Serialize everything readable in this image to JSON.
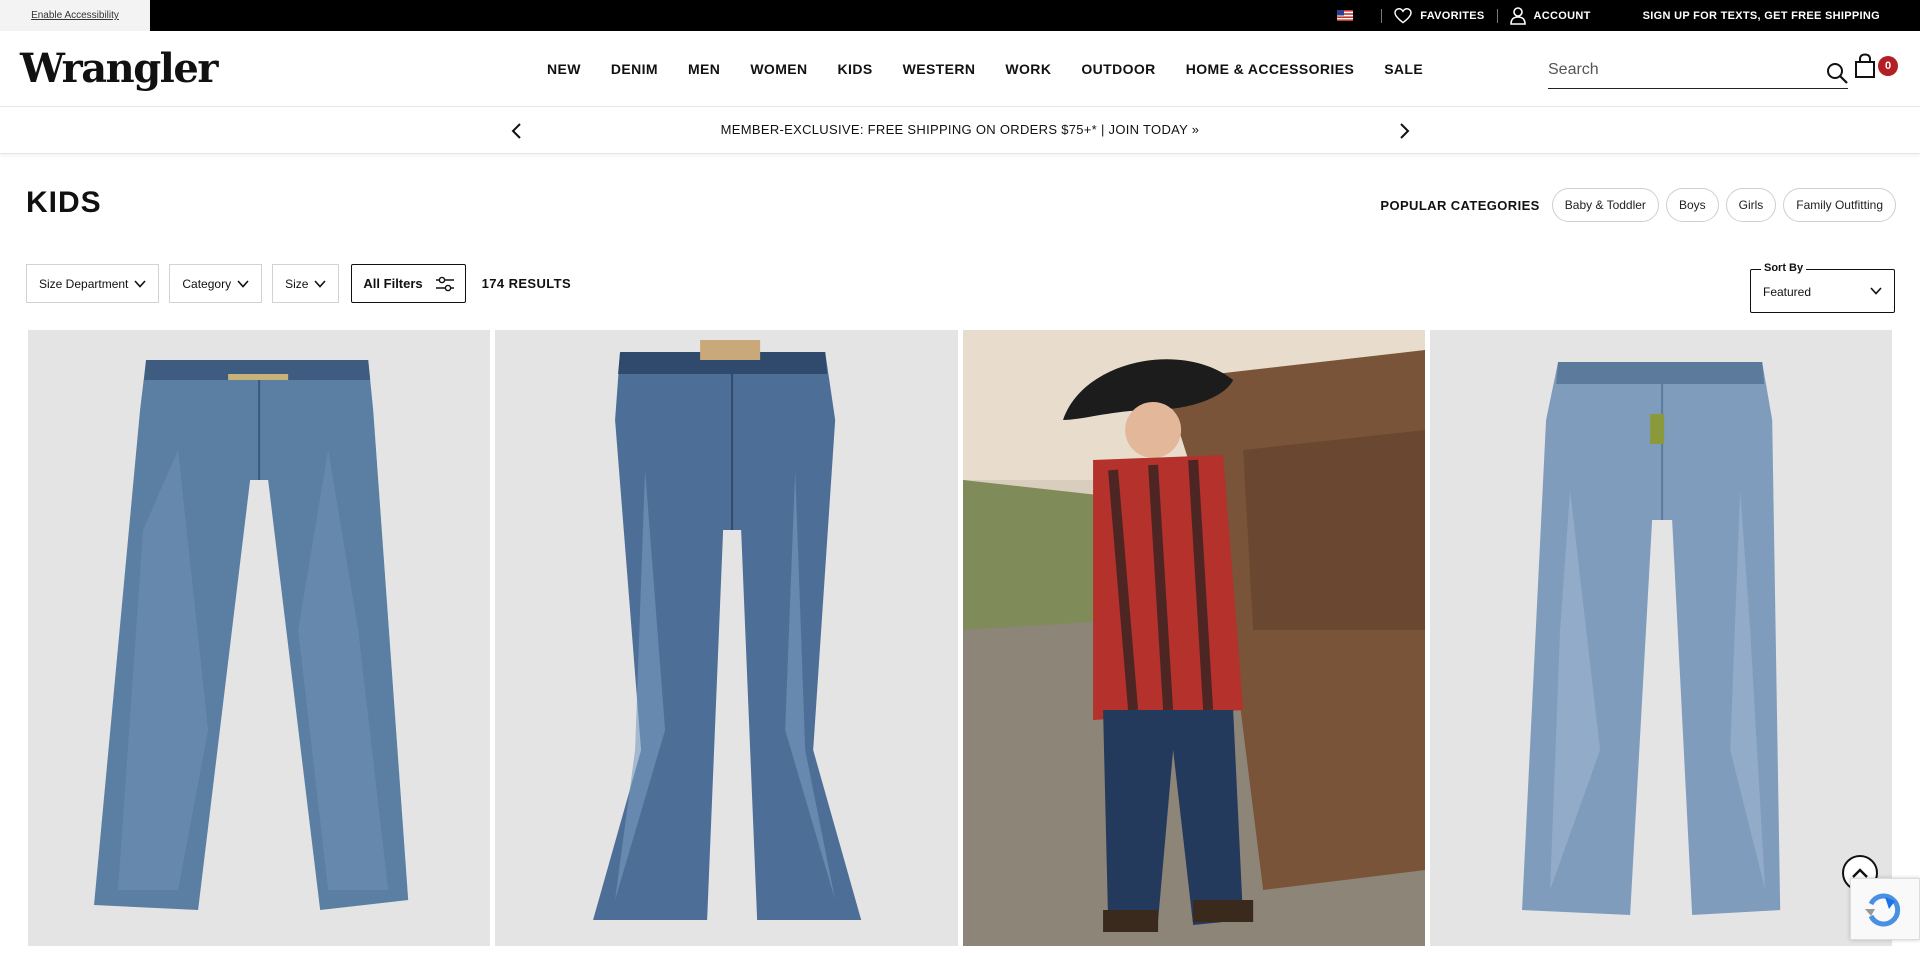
{
  "utility": {
    "accessibility": "Enable Accessibility",
    "favorites": "FAVORITES",
    "account": "ACCOUNT",
    "sms": "SIGN UP FOR TEXTS, GET FREE SHIPPING"
  },
  "header": {
    "logo": "Wrangler",
    "nav": [
      "NEW",
      "DENIM",
      "MEN",
      "WOMEN",
      "KIDS",
      "WESTERN",
      "WORK",
      "OUTDOOR",
      "HOME & ACCESSORIES",
      "SALE"
    ],
    "search_placeholder": "Search",
    "bag_count": "0"
  },
  "promo": {
    "text": "MEMBER-EXCLUSIVE: FREE SHIPPING ON ORDERS $75+* | JOIN TODAY »"
  },
  "page": {
    "title": "KIDS",
    "popular_label": "POPULAR CATEGORIES",
    "categories": [
      "Baby & Toddler",
      "Boys",
      "Girls",
      "Family Outfitting"
    ]
  },
  "filters": {
    "buttons": [
      "Size Department",
      "Category",
      "Size"
    ],
    "all_filters": "All Filters",
    "results": "174 RESULTS"
  },
  "sort": {
    "label": "Sort By",
    "value": "Featured"
  },
  "colors": {
    "top_bar": "#000000",
    "badge": "#b21f24",
    "tile_bg": "#e4e4e4",
    "denim_dark": "#4a6a8c",
    "denim_light": "#7f9cb9"
  },
  "products": [
    {
      "image": "relaxed-boot-jeans-mid-wash"
    },
    {
      "image": "bootcut-jeans-medium-wash"
    },
    {
      "image": "boy-in-cowboy-hat-and-plaid-jacket-by-truck"
    },
    {
      "image": "slim-straight-jeans-light-wash"
    }
  ]
}
